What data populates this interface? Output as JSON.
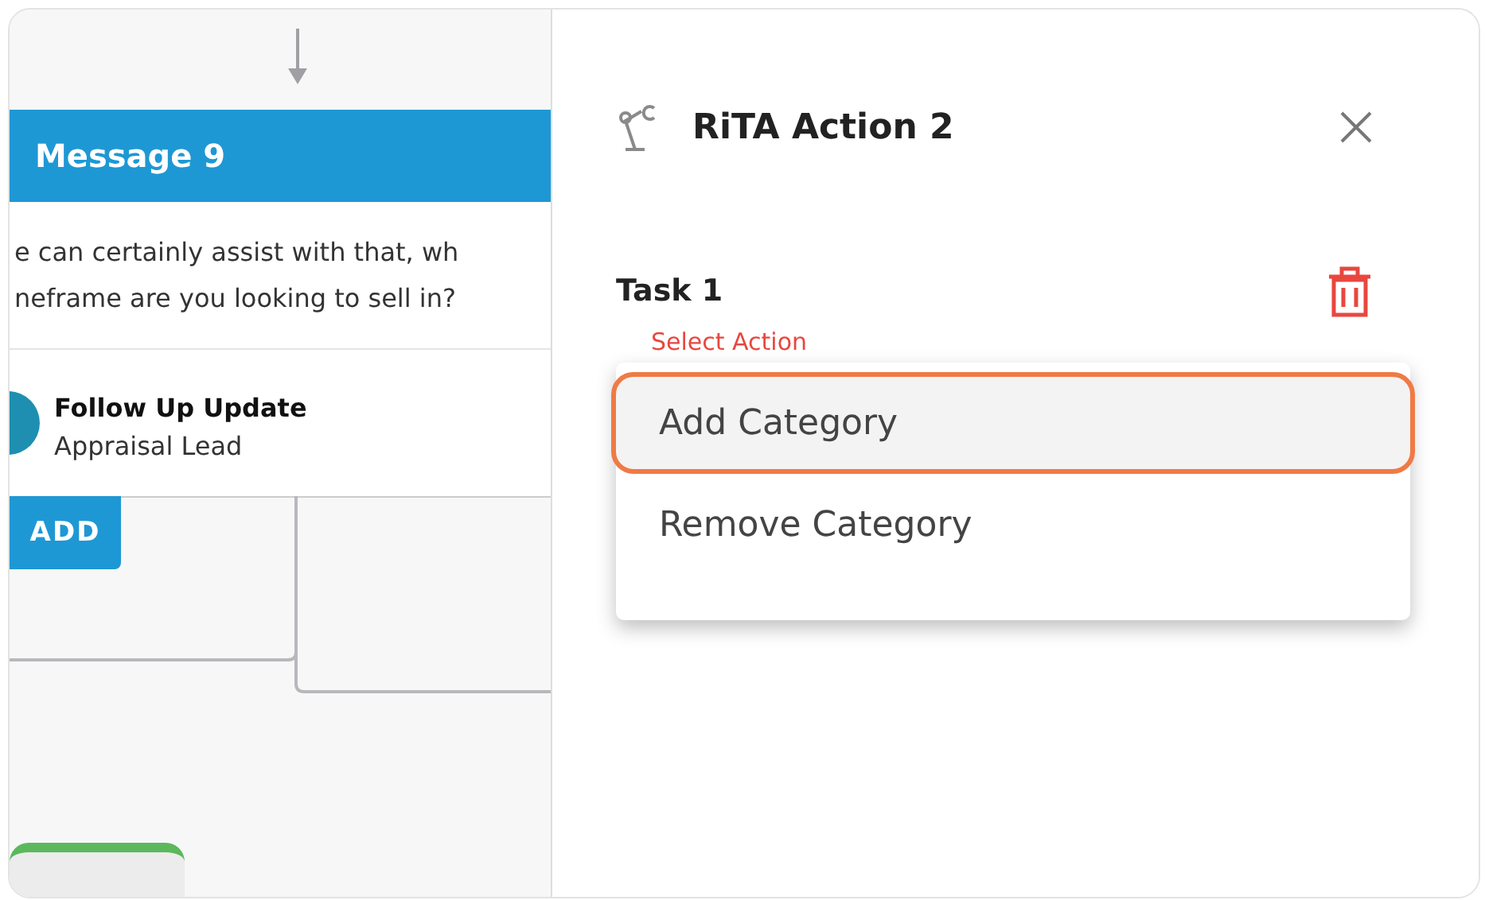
{
  "canvas": {
    "message_node": {
      "title": "Message 9",
      "text_lines": [
        "e can certainly assist with that, wh",
        "neframe are you looking to sell in?"
      ]
    },
    "action_node": {
      "title": "Follow Up Update",
      "subtitle": "Appraisal Lead"
    },
    "add_button": "ADD"
  },
  "panel": {
    "title": "RiTA Action 2",
    "task_label": "Task 1",
    "select_label": "Select Action",
    "menu": [
      {
        "label": "Add Category",
        "selected": true
      },
      {
        "label": "Remove Category",
        "selected": false
      }
    ]
  }
}
